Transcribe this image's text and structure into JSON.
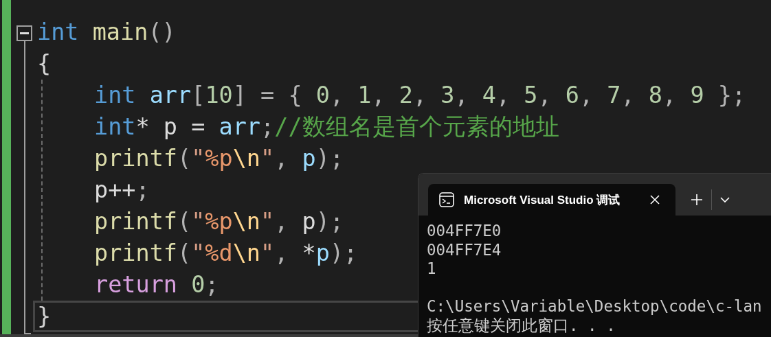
{
  "editor": {
    "fold_expanded": true,
    "signature": [
      {
        "kind": "type",
        "text": "int "
      },
      {
        "kind": "function",
        "text": "main"
      },
      {
        "kind": "punct",
        "text": "()"
      }
    ],
    "open_brace": "{",
    "body": [
      [
        {
          "kind": "type",
          "text": "int "
        },
        {
          "kind": "variable",
          "text": "arr"
        },
        {
          "kind": "punct",
          "text": "["
        },
        {
          "kind": "number",
          "text": "10"
        },
        {
          "kind": "punct",
          "text": "] = { "
        },
        {
          "kind": "number",
          "text": "0"
        },
        {
          "kind": "punct",
          "text": ", "
        },
        {
          "kind": "number",
          "text": "1"
        },
        {
          "kind": "punct",
          "text": ", "
        },
        {
          "kind": "number",
          "text": "2"
        },
        {
          "kind": "punct",
          "text": ", "
        },
        {
          "kind": "number",
          "text": "3"
        },
        {
          "kind": "punct",
          "text": ", "
        },
        {
          "kind": "number",
          "text": "4"
        },
        {
          "kind": "punct",
          "text": ", "
        },
        {
          "kind": "number",
          "text": "5"
        },
        {
          "kind": "punct",
          "text": ", "
        },
        {
          "kind": "number",
          "text": "6"
        },
        {
          "kind": "punct",
          "text": ", "
        },
        {
          "kind": "number",
          "text": "7"
        },
        {
          "kind": "punct",
          "text": ", "
        },
        {
          "kind": "number",
          "text": "8"
        },
        {
          "kind": "punct",
          "text": ", "
        },
        {
          "kind": "number",
          "text": "9"
        },
        {
          "kind": "punct",
          "text": " };"
        }
      ],
      [
        {
          "kind": "type",
          "text": "int"
        },
        {
          "kind": "plain",
          "text": "* p = "
        },
        {
          "kind": "variable",
          "text": "arr"
        },
        {
          "kind": "punct",
          "text": ";"
        },
        {
          "kind": "comment",
          "text": "//数组名是首个元素的地址"
        }
      ],
      [
        {
          "kind": "function",
          "text": "printf"
        },
        {
          "kind": "punct",
          "text": "("
        },
        {
          "kind": "string",
          "text": "\""
        },
        {
          "kind": "format",
          "text": "%p"
        },
        {
          "kind": "escape",
          "text": "\\n"
        },
        {
          "kind": "string",
          "text": "\""
        },
        {
          "kind": "punct",
          "text": ", "
        },
        {
          "kind": "variable",
          "text": "p"
        },
        {
          "kind": "punct",
          "text": ");"
        }
      ],
      [
        {
          "kind": "plain",
          "text": "p++"
        },
        {
          "kind": "punct",
          "text": ";"
        }
      ],
      [
        {
          "kind": "function",
          "text": "printf"
        },
        {
          "kind": "punct",
          "text": "("
        },
        {
          "kind": "string",
          "text": "\""
        },
        {
          "kind": "format",
          "text": "%p"
        },
        {
          "kind": "escape",
          "text": "\\n"
        },
        {
          "kind": "string",
          "text": "\""
        },
        {
          "kind": "punct",
          "text": ", "
        },
        {
          "kind": "plain",
          "text": "p"
        },
        {
          "kind": "punct",
          "text": ");"
        }
      ],
      [
        {
          "kind": "function",
          "text": "printf"
        },
        {
          "kind": "punct",
          "text": "("
        },
        {
          "kind": "string",
          "text": "\""
        },
        {
          "kind": "format",
          "text": "%d"
        },
        {
          "kind": "escape",
          "text": "\\n"
        },
        {
          "kind": "string",
          "text": "\""
        },
        {
          "kind": "punct",
          "text": ", "
        },
        {
          "kind": "plain",
          "text": "*"
        },
        {
          "kind": "variable",
          "text": "p"
        },
        {
          "kind": "punct",
          "text": ");"
        }
      ],
      [
        {
          "kind": "control",
          "text": "return "
        },
        {
          "kind": "number",
          "text": "0"
        },
        {
          "kind": "punct",
          "text": ";"
        }
      ]
    ],
    "close_brace": "}",
    "close_brace_current": true
  },
  "terminal": {
    "tabs": [
      {
        "title": "Microsoft Visual Studio 调试",
        "selected": true
      }
    ],
    "output": [
      "004FF7E0",
      "004FF7E4",
      "1"
    ],
    "exit_message": [
      "C:\\Users\\Variable\\Desktop\\code\\c-lan",
      "按任意键关闭此窗口. . ."
    ]
  }
}
